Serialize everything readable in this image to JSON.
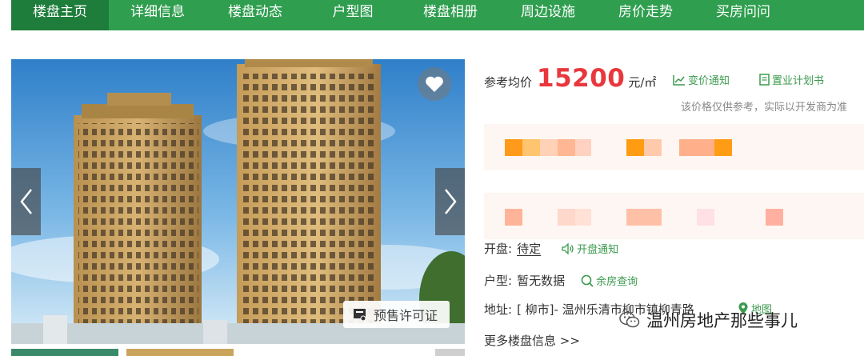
{
  "nav": {
    "items": [
      {
        "label": "楼盘主页",
        "active": true
      },
      {
        "label": "详细信息",
        "active": false
      },
      {
        "label": "楼盘动态",
        "active": false
      },
      {
        "label": "户型图",
        "active": false
      },
      {
        "label": "楼盘相册",
        "active": false
      },
      {
        "label": "周边设施",
        "active": false
      },
      {
        "label": "房价走势",
        "active": false
      },
      {
        "label": "买房问问",
        "active": false
      }
    ]
  },
  "gallery": {
    "permit_label": "预售许可证",
    "icons": {
      "favorite": "heart-icon",
      "prev": "chevron-left-icon",
      "next": "chevron-right-icon",
      "permit": "certificate-icon"
    }
  },
  "price": {
    "label": "参考均价",
    "value": "15200",
    "unit": "元/㎡",
    "change_notice": "变价通知",
    "purchase_plan": "置业计划书",
    "note": "该价格仅供参考，实际以开发商为准"
  },
  "details": {
    "opening_label": "开盘:",
    "opening_value": "待定",
    "opening_notice": "开盘通知",
    "layout_label": "户型:",
    "layout_value": "暂无数据",
    "room_query": "余房查询",
    "address_label": "地址:",
    "address_value": "[ 柳市]- 温州乐清市柳市镇柳青路",
    "map_link": "地图",
    "more_info": "更多楼盘信息 >>"
  },
  "watermark": {
    "text": "温州房地产那些事儿"
  },
  "colors": {
    "nav_bg": "#2f9e4f",
    "nav_active": "#1e7d3a",
    "price": "#e8383d",
    "link": "#3b9a4e"
  }
}
